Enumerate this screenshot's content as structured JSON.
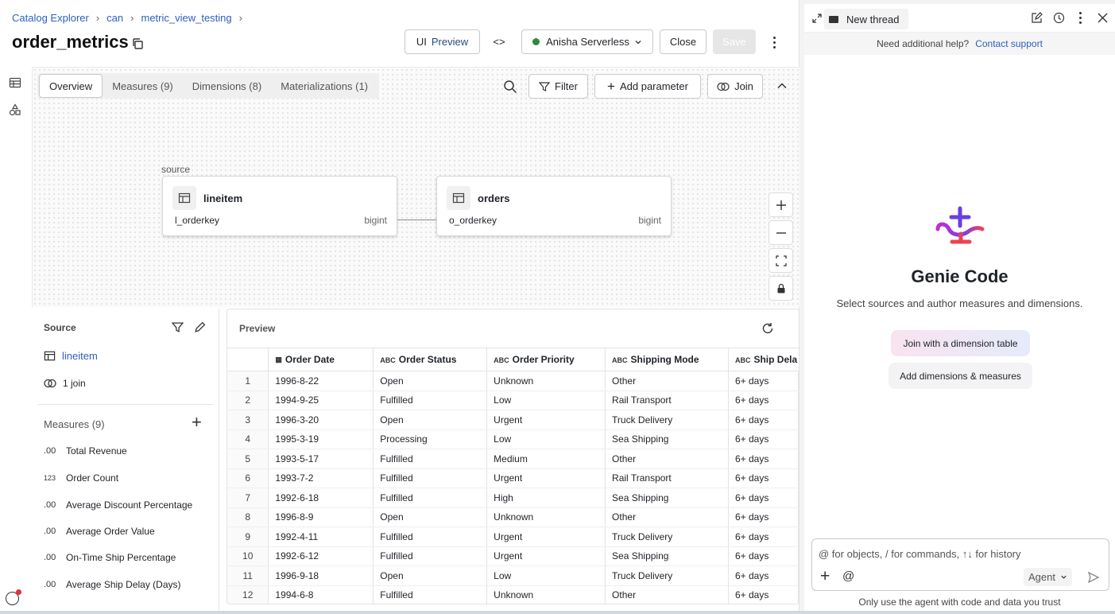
{
  "breadcrumb": [
    "Catalog Explorer",
    "can",
    "metric_view_testing"
  ],
  "page_title": "order_metrics",
  "toolbar": {
    "ui_label": "UI",
    "preview_label": "Preview",
    "code_toggle": "<>",
    "compute_name": "Anisha Serverless",
    "compute_status_color": "#2e8b3a",
    "close_label": "Close",
    "save_label": "Save"
  },
  "tabs": [
    "Overview",
    "Measures (9)",
    "Dimensions (8)",
    "Materializations (1)"
  ],
  "canvas_actions": {
    "filter": "Filter",
    "add_parameter": "Add parameter",
    "join": "Join"
  },
  "graph": {
    "source_label": "source",
    "nodes": [
      {
        "name": "lineitem",
        "column": "l_orderkey",
        "type": "bigint"
      },
      {
        "name": "orders",
        "column": "o_orderkey",
        "type": "bigint"
      }
    ]
  },
  "source_panel": {
    "source_heading": "Source",
    "source_table": "lineitem",
    "joins": "1 join",
    "measures_heading": "Measures (9)",
    "measures": [
      {
        "type": ".00",
        "name": "Total Revenue"
      },
      {
        "type": "123",
        "name": "Order Count"
      },
      {
        "type": ".00",
        "name": "Average Discount Percentage"
      },
      {
        "type": ".00",
        "name": "Average Order Value"
      },
      {
        "type": ".00",
        "name": "On-Time Ship Percentage"
      },
      {
        "type": ".00",
        "name": "Average Ship Delay (Days)"
      }
    ]
  },
  "preview": {
    "title": "Preview",
    "columns": [
      "Order Date",
      "Order Status",
      "Order Priority",
      "Shipping Mode",
      "Ship Dela"
    ],
    "rows": [
      [
        "1",
        "1996-8-22",
        "Open",
        "Unknown",
        "Other",
        "6+ days"
      ],
      [
        "2",
        "1994-9-25",
        "Fulfilled",
        "Low",
        "Rail Transport",
        "6+ days"
      ],
      [
        "3",
        "1996-3-20",
        "Open",
        "Urgent",
        "Truck Delivery",
        "6+ days"
      ],
      [
        "4",
        "1995-3-19",
        "Processing",
        "Low",
        "Sea Shipping",
        "6+ days"
      ],
      [
        "5",
        "1993-5-17",
        "Fulfilled",
        "Medium",
        "Other",
        "6+ days"
      ],
      [
        "6",
        "1993-7-2",
        "Fulfilled",
        "Urgent",
        "Rail Transport",
        "6+ days"
      ],
      [
        "7",
        "1992-6-18",
        "Fulfilled",
        "High",
        "Sea Shipping",
        "6+ days"
      ],
      [
        "8",
        "1996-8-9",
        "Open",
        "Unknown",
        "Other",
        "6+ days"
      ],
      [
        "9",
        "1992-4-11",
        "Fulfilled",
        "Urgent",
        "Truck Delivery",
        "6+ days"
      ],
      [
        "10",
        "1992-6-12",
        "Fulfilled",
        "Urgent",
        "Sea Shipping",
        "6+ days"
      ],
      [
        "11",
        "1996-9-18",
        "Open",
        "Low",
        "Truck Delivery",
        "6+ days"
      ],
      [
        "12",
        "1994-6-8",
        "Fulfilled",
        "Unknown",
        "Other",
        "6+ days"
      ]
    ]
  },
  "assistant": {
    "tab_label": "New thread",
    "help_text": "Need additional help?",
    "help_link": "Contact support",
    "title": "Genie Code",
    "subtitle": "Select sources and author measures and dimensions.",
    "suggestions": [
      "Join with a dimension table",
      "Add dimensions & measures"
    ],
    "input_placeholder": "@ for objects, / for commands, ↑↓ for history",
    "mode": "Agent",
    "footer": "Only use the agent with code and data you trust"
  }
}
